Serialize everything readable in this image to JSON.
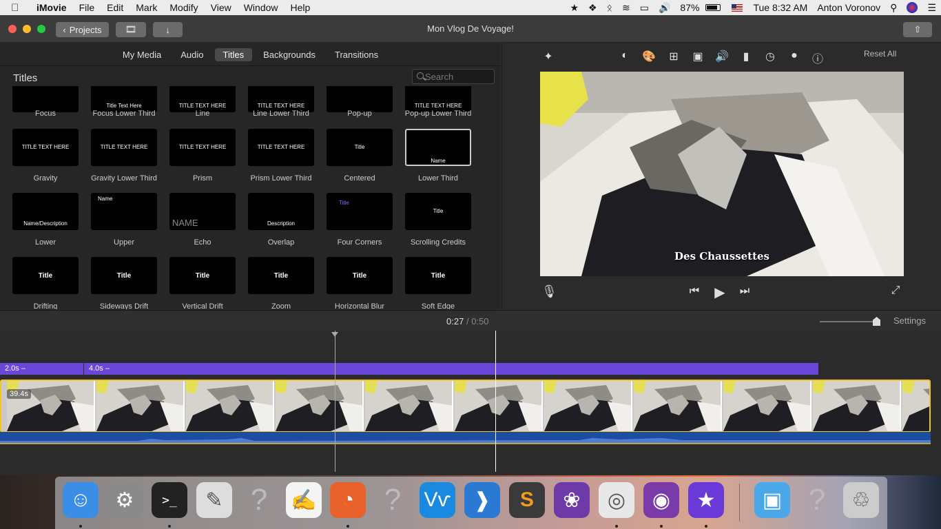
{
  "menubar": {
    "app": "iMovie",
    "items": [
      "File",
      "Edit",
      "Mark",
      "Modify",
      "View",
      "Window",
      "Help"
    ],
    "battery": "87%",
    "clock": "Tue 8:32 AM",
    "user": "Anton Voronov"
  },
  "window": {
    "title": "Mon Vlog De Voyage!",
    "projects_label": "Projects"
  },
  "browser": {
    "tabs": [
      "My Media",
      "Audio",
      "Titles",
      "Backgrounds",
      "Transitions"
    ],
    "active_tab": "Titles",
    "heading": "Titles",
    "search_placeholder": "Search",
    "titles": [
      {
        "label": "Focus"
      },
      {
        "label": "Focus Lower Third",
        "text": "Title Text Here"
      },
      {
        "label": "Line",
        "text": "TITLE TEXT HERE"
      },
      {
        "label": "Line Lower Third",
        "text": "TITLE TEXT HERE"
      },
      {
        "label": "Pop-up"
      },
      {
        "label": "Pop-up Lower Third",
        "text": "TITLE TEXT HERE"
      },
      {
        "label": "Gravity",
        "text": "TITLE TEXT HERE"
      },
      {
        "label": "Gravity Lower Third",
        "text": "TITLE TEXT HERE"
      },
      {
        "label": "Prism",
        "text": "TITLE TEXT HERE"
      },
      {
        "label": "Prism Lower Third",
        "text": "TITLE TEXT HERE"
      },
      {
        "label": "Centered",
        "text": "Title"
      },
      {
        "label": "Lower Third",
        "text": "Name"
      },
      {
        "label": "Lower",
        "text": "Name/Description"
      },
      {
        "label": "Upper",
        "text": "Name"
      },
      {
        "label": "Echo",
        "text": "NAME"
      },
      {
        "label": "Overlap",
        "text": "Description"
      },
      {
        "label": "Four Corners",
        "text": "Title"
      },
      {
        "label": "Scrolling Credits",
        "text": "Title"
      },
      {
        "label": "Drifting",
        "text": "Title"
      },
      {
        "label": "Sideways Drift",
        "text": "Title"
      },
      {
        "label": "Vertical Drift",
        "text": "Title"
      },
      {
        "label": "Zoom",
        "text": "Title"
      },
      {
        "label": "Horizontal Blur",
        "text": "Title"
      },
      {
        "label": "Soft Edge",
        "text": "Title"
      }
    ],
    "selected": "Lower Third"
  },
  "viewer": {
    "reset_label": "Reset All",
    "caption": "Des Chaussettes"
  },
  "timeline": {
    "current": "0:27",
    "separator": "/",
    "total": "0:50",
    "settings_label": "Settings",
    "title_clip_1": "2.0s –",
    "title_clip_2": "4.0s –",
    "video_duration": "39.4s"
  },
  "dock": [
    {
      "name": "finder-icon",
      "color": "#3a8ee6",
      "dot": true
    },
    {
      "name": "system-preferences-icon",
      "color": "#8a8a8a",
      "dot": false
    },
    {
      "name": "terminal-icon",
      "color": "#222",
      "dot": true
    },
    {
      "name": "script-editor-icon",
      "color": "#ddd",
      "dot": false
    },
    {
      "name": "unknown-app-icon",
      "color": "transparent",
      "dot": false
    },
    {
      "name": "textedit-icon",
      "color": "#f4f4f4",
      "dot": false
    },
    {
      "name": "firefox-icon",
      "color": "#e8602a",
      "dot": true
    },
    {
      "name": "unknown-app-icon-2",
      "color": "transparent",
      "dot": false
    },
    {
      "name": "vnc-viewer-icon",
      "color": "#1a8ae0",
      "dot": false
    },
    {
      "name": "vscode-icon",
      "color": "#2a7ad4",
      "dot": false
    },
    {
      "name": "sublime-text-icon",
      "color": "#3a3a3a",
      "dot": false
    },
    {
      "name": "github-desktop-icon",
      "color": "#6e3aa8",
      "dot": false
    },
    {
      "name": "chrome-icon",
      "color": "#e8e8e8",
      "dot": true
    },
    {
      "name": "tor-browser-icon",
      "color": "#7a3aa8",
      "dot": true
    },
    {
      "name": "imovie-icon",
      "color": "#6a3ad8",
      "dot": true
    },
    {
      "name": "downloads-folder-icon",
      "color": "#4aa8e8",
      "dot": false
    },
    {
      "name": "unknown-app-icon-3",
      "color": "transparent",
      "dot": false
    },
    {
      "name": "trash-icon",
      "color": "#ccc",
      "dot": false
    }
  ]
}
